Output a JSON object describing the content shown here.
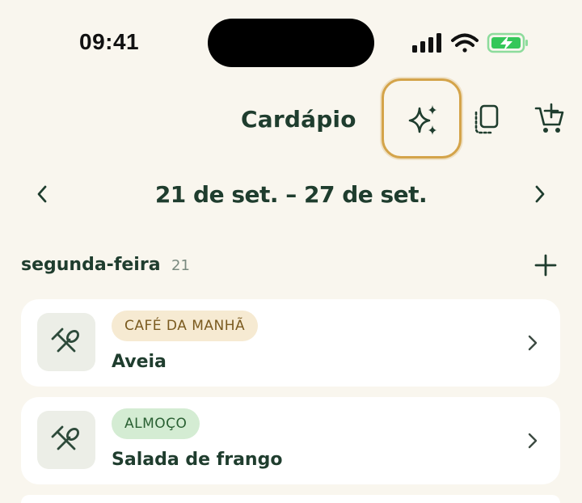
{
  "status_bar": {
    "time": "09:41"
  },
  "header": {
    "title": "Cardápio",
    "icons": [
      "sparkles-icon",
      "copy-icon",
      "add-to-cart-icon"
    ]
  },
  "week": {
    "label": "21 de set. – 27 de set."
  },
  "day": {
    "name": "segunda-feira",
    "number": "21"
  },
  "meals": [
    {
      "badge": "CAFÉ DA MANHÃ",
      "name": "Aveia",
      "badge_color": "#f6ead2"
    },
    {
      "badge": "ALMOÇO",
      "name": "Salada de frango",
      "badge_color": "#d4ecd3"
    }
  ],
  "colors": {
    "background": "#f9f6ee",
    "primary_text": "#1f3d2e",
    "highlight_ring": "#d4a44a",
    "battery": "#34c759"
  }
}
